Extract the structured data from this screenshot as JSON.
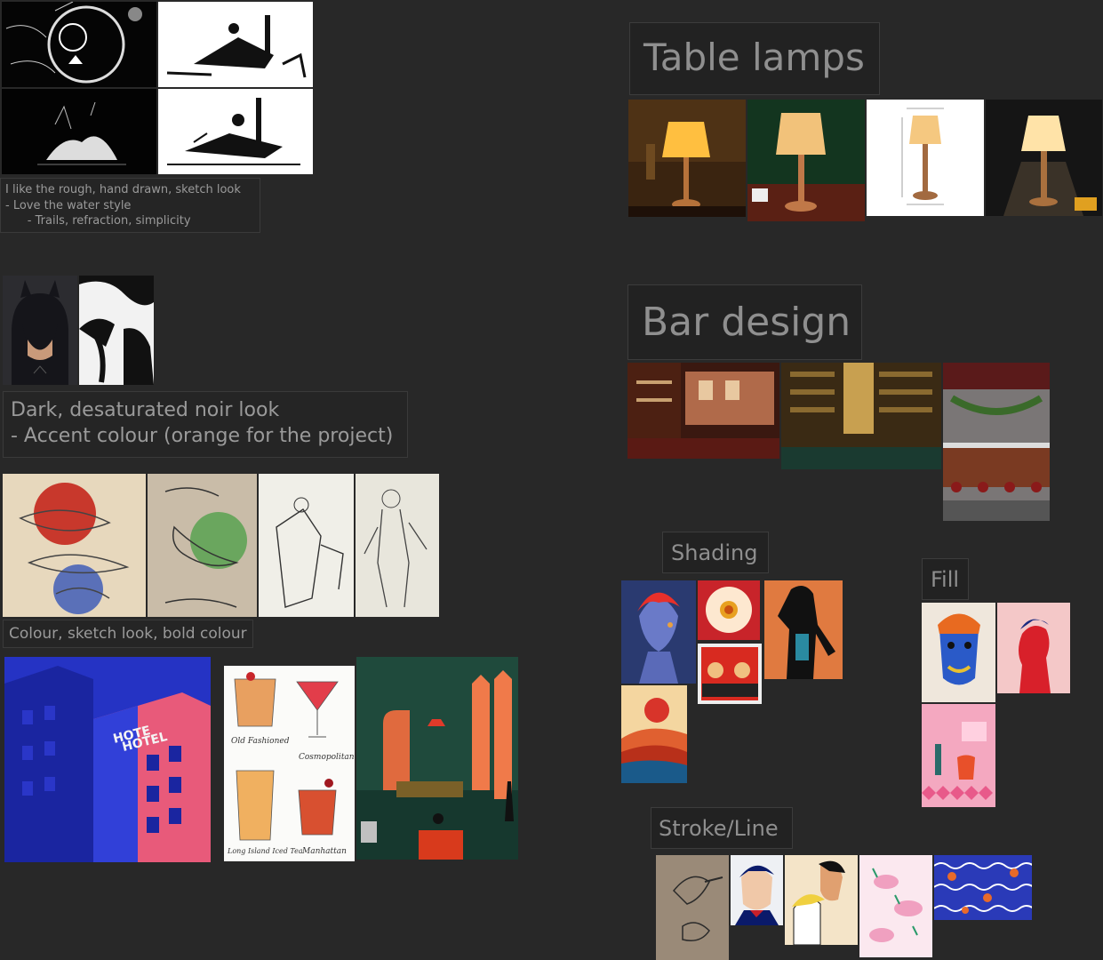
{
  "notes": {
    "sketch": {
      "lines": [
        "I like the rough, hand drawn, sketch look",
        "- Love the water style",
        "      - Trails, refraction, simplicity"
      ]
    },
    "noir": {
      "lines": [
        "Dark, desaturated noir look",
        "- Accent colour (orange for the project)"
      ]
    },
    "colour": {
      "text": "Colour, sketch look, bold colour"
    }
  },
  "headings": {
    "table_lamps": "Table lamps",
    "bar_design": "Bar design",
    "shading": "Shading",
    "fill": "Fill",
    "stroke_line": "Stroke/Line"
  },
  "image_text": {
    "hotel_sign_1": "HOTE",
    "hotel_sign_2": "HOTEL",
    "cocktail_1": "Old Fashioned",
    "cocktail_2": "Cosmopolitan",
    "cocktail_3": "Long Island Iced Tea",
    "cocktail_4": "Manhattan"
  },
  "colors": {
    "canvas": "#282828",
    "note_bg": "#252525",
    "accent_orange": "#e8542a",
    "accent_blue": "#2a3bd6"
  }
}
